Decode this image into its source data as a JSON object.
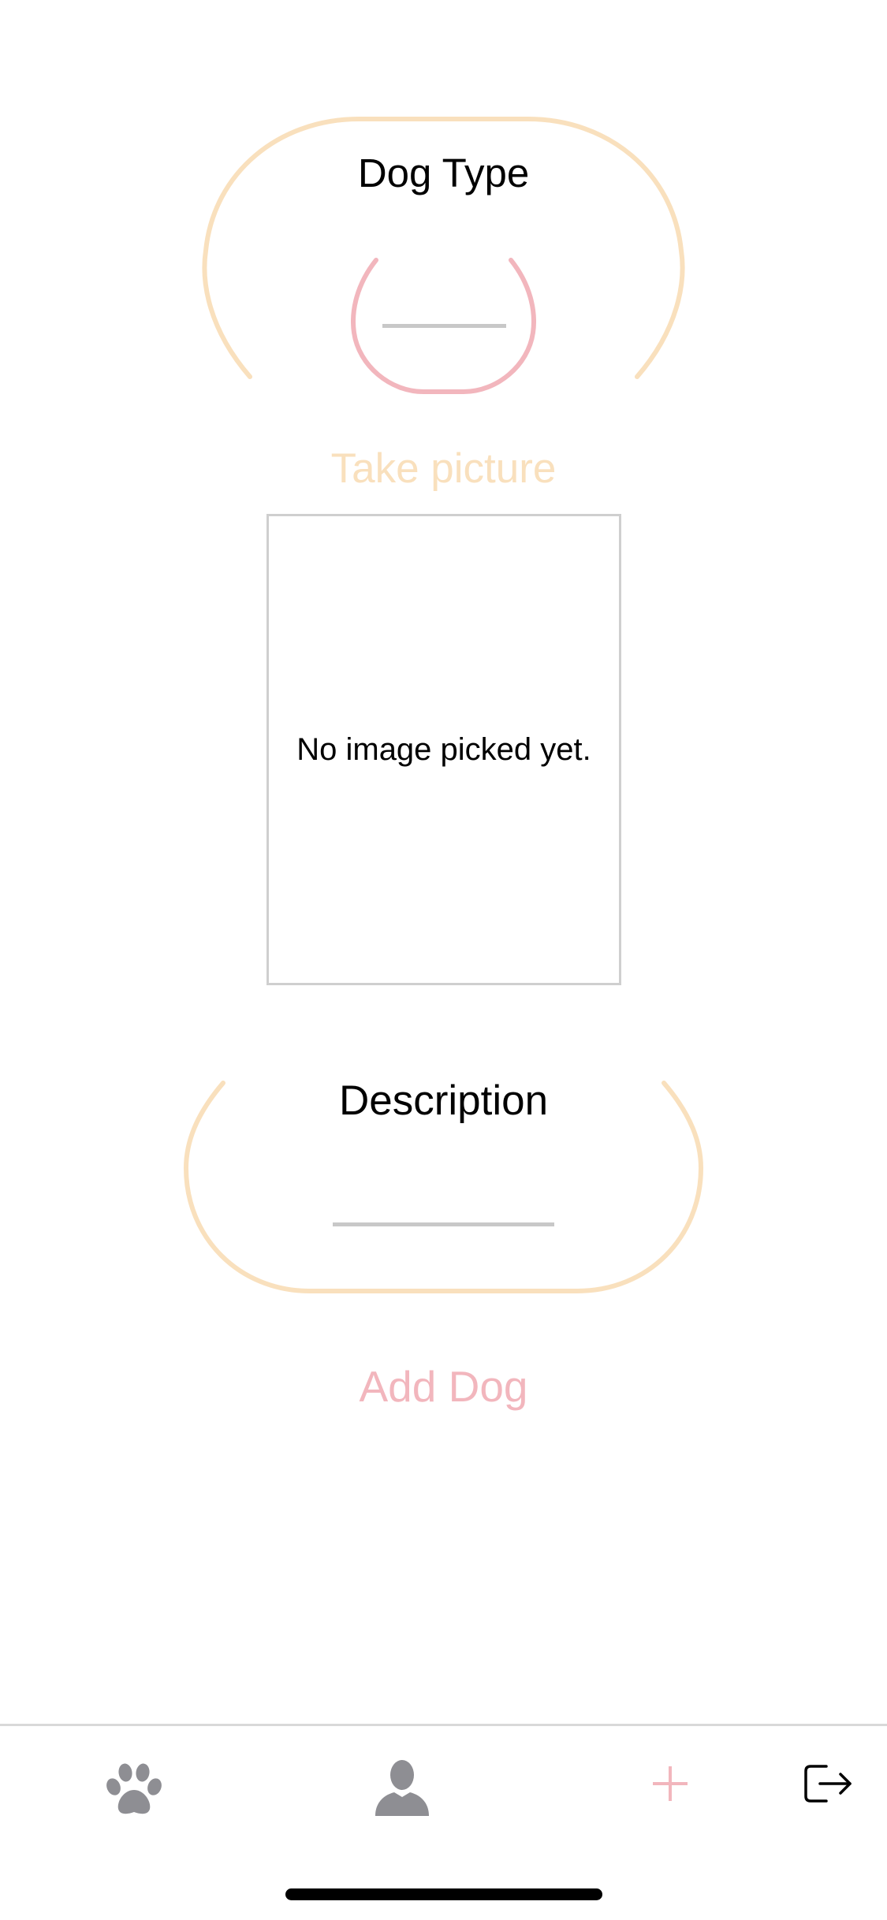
{
  "form": {
    "dog_type_label": "Dog Type",
    "take_picture_label": "Take picture",
    "image_placeholder": "No image picked yet.",
    "description_label": "Description",
    "add_dog_label": "Add Dog"
  },
  "tabbar": {
    "items": [
      {
        "icon": "paw-icon",
        "active": false
      },
      {
        "icon": "profile-icon",
        "active": false
      },
      {
        "icon": "plus-icon",
        "active": true
      },
      {
        "icon": "logout-icon",
        "active": false
      }
    ]
  },
  "colors": {
    "accent_pink": "#f2b6bd",
    "accent_beige": "#f9e0bd",
    "tab_inactive": "#8e8e93"
  }
}
